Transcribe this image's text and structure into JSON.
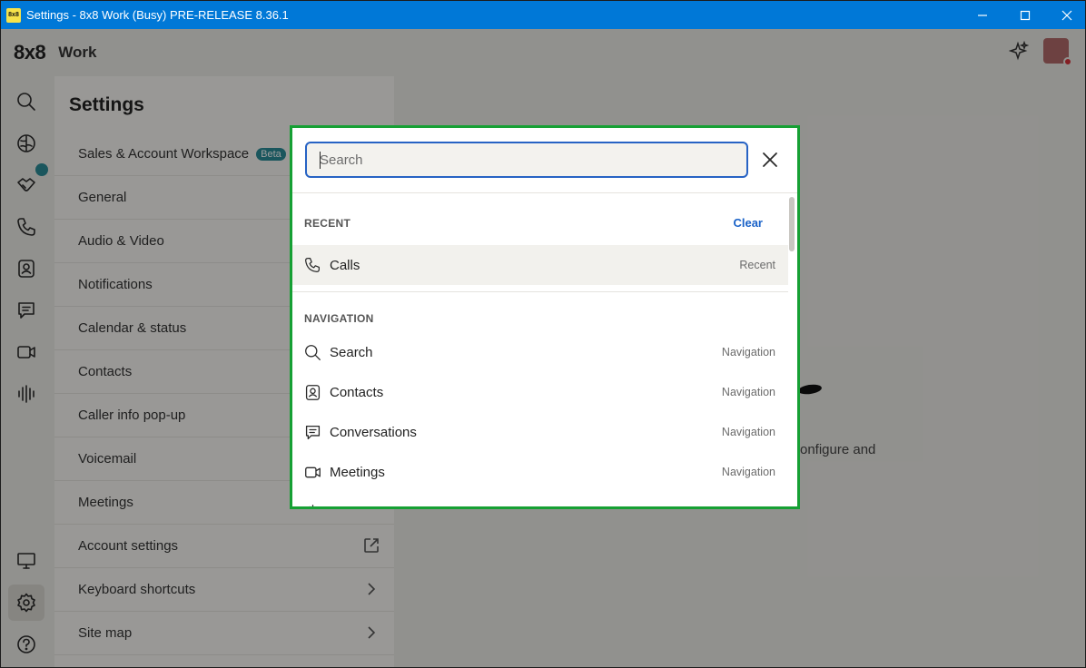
{
  "window": {
    "title": "Settings - 8x8 Work (Busy) PRE-RELEASE 8.36.1",
    "logo_text": "8x8"
  },
  "app": {
    "brand": "8x8",
    "product": "Work",
    "settings": {
      "title": "Settings",
      "items": [
        {
          "label": "Sales & Account Workspace",
          "badge": "Beta"
        },
        {
          "label": "General"
        },
        {
          "label": "Audio & Video"
        },
        {
          "label": "Notifications"
        },
        {
          "label": "Calendar & status"
        },
        {
          "label": "Contacts"
        },
        {
          "label": "Caller info pop-up"
        },
        {
          "label": "Voicemail"
        },
        {
          "label": "Meetings"
        },
        {
          "label": "Account settings",
          "trail_icon": "external-link-icon"
        },
        {
          "label": "Keyboard shortcuts",
          "trail_icon": "chevron-right-icon"
        },
        {
          "label": "Site map",
          "trail_icon": "chevron-right-icon"
        }
      ]
    },
    "background_text": "onfigure and"
  },
  "dialog": {
    "search": {
      "placeholder": "Search",
      "value": ""
    },
    "recent": {
      "heading": "RECENT",
      "clear_label": "Clear",
      "items": [
        {
          "icon": "phone-icon",
          "label": "Calls",
          "kind": "Recent"
        }
      ]
    },
    "navigation": {
      "heading": "NAVIGATION",
      "items": [
        {
          "icon": "search-icon",
          "label": "Search",
          "kind": "Navigation"
        },
        {
          "icon": "contacts-icon",
          "label": "Contacts",
          "kind": "Navigation"
        },
        {
          "icon": "chat-icon",
          "label": "Conversations",
          "kind": "Navigation"
        },
        {
          "icon": "video-icon",
          "label": "Meetings",
          "kind": "Navigation"
        }
      ]
    }
  },
  "colors": {
    "titlebar": "#0078d7",
    "dialog_border": "#16a034",
    "search_focus": "#2763c4",
    "link": "#1a62c8",
    "beta_badge": "#2a8c96"
  }
}
